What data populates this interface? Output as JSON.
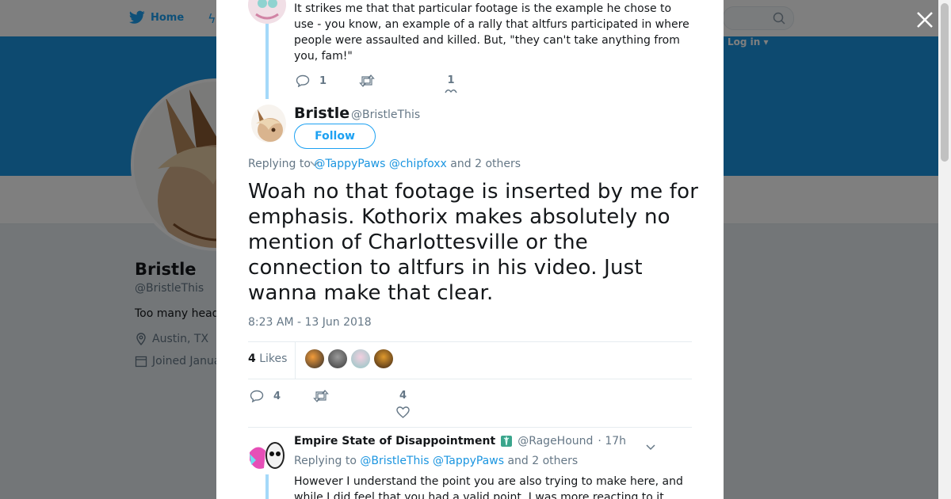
{
  "nav": {
    "home_label": "Home",
    "login_label": "Log in ▾"
  },
  "profile_bg": {
    "name": "Bristle",
    "handle": "@BristleThis",
    "bio_fragment": "Too many head",
    "location": "Austin, TX",
    "joined_fragment": "Joined Janua"
  },
  "prev_tweet": {
    "text": "It strikes me that that particular footage is the example he chose to use - you know, an example of a rally that altfurs participated in where people were assaulted and killed. But, \"they can't take anything from you, fam!\"",
    "reply_count": "1",
    "like_count": "1"
  },
  "main_tweet": {
    "display_name": "Bristle",
    "handle": "@BristleThis",
    "follow_label": "Follow",
    "replying_prefix": "Replying to",
    "replying_users": [
      "@TappyPaws",
      "@chipfoxx"
    ],
    "replying_suffix": "and 2 others",
    "text": "Woah no that footage is inserted by me for emphasis. Kothorix makes absolutely no mention of Charlottesville or the connection to altfurs in his video. Just wanna make that clear.",
    "timestamp": "8:23 AM - 13 Jun 2018",
    "likes_count": "4",
    "likes_label": "Likes",
    "reply_count": "4",
    "like_count": "4"
  },
  "reply_tweet": {
    "display_name": "Empire State of Disappointment",
    "handle": "@RageHound",
    "time": "· 17h",
    "replying_prefix": "Replying to",
    "replying_users": [
      "@BristleThis",
      "@TappyPaws"
    ],
    "replying_suffix": "and 2 others",
    "text": "However I understand the point you are also trying to make here, and while I did feel that you had a valid point, I was more reacting to it"
  },
  "colors": {
    "accent": "#1da1f2",
    "link": "#1b95e0",
    "thread_line": "#a4d9f9",
    "banner": "#1b95e0"
  }
}
